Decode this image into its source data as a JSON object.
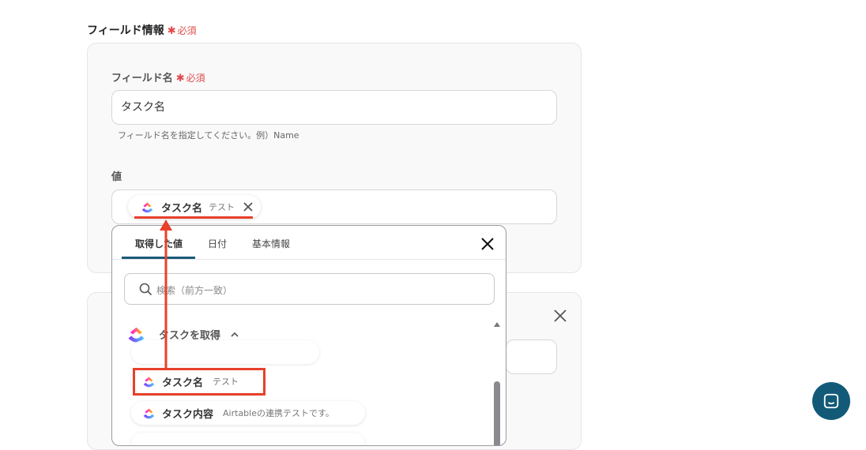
{
  "section": {
    "title": "フィールド情報",
    "required": "必須",
    "required_star": "✱"
  },
  "field_name": {
    "label": "フィールド名",
    "required": "必須",
    "value": "タスク名",
    "hint": "フィールド名を指定してください。例）Name"
  },
  "value_field": {
    "label": "値",
    "chip_name": "タスク名",
    "chip_sub": "テスト"
  },
  "dropdown": {
    "tabs": [
      "取得した値",
      "日付",
      "基本情報"
    ],
    "search_placeholder": "検索（前方一致）",
    "group_label": "タスクを取得",
    "items": [
      {
        "name": "タスク名",
        "sub": "テスト"
      },
      {
        "name": "タスク内容",
        "sub": "Airtableの連携テストです。"
      }
    ]
  },
  "colors": {
    "accent": "#125a78",
    "highlight": "#e8402a",
    "required": "#e24a4a"
  }
}
